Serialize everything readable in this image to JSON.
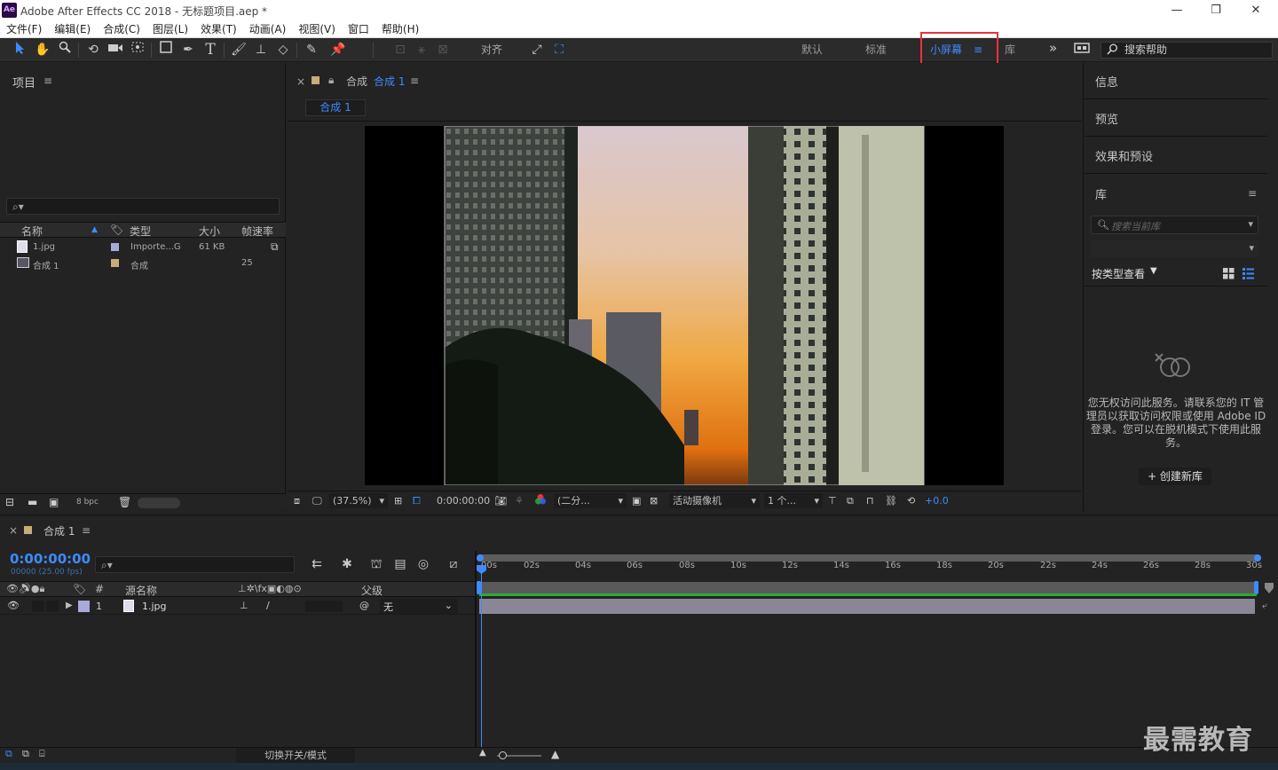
{
  "titlebar": {
    "logo": "Ae",
    "title": "Adobe After Effects CC 2018 - 无标题项目.aep *",
    "minimize": "—",
    "restore": "❐",
    "close": "✕"
  },
  "menu": [
    "文件(F)",
    "编辑(E)",
    "合成(C)",
    "图层(L)",
    "效果(T)",
    "动画(A)",
    "视图(V)",
    "窗口",
    "帮助(H)"
  ],
  "toolbar": {
    "snap_label": "对齐",
    "workspaces": [
      "默认",
      "标准",
      "小屏幕",
      "库"
    ],
    "active_workspace": "小屏幕",
    "overflow": "»",
    "search_placeholder": "搜索帮助"
  },
  "project": {
    "title": "项目",
    "columns": [
      "名称",
      "类型",
      "大小",
      "帧速率"
    ],
    "items": [
      {
        "name": "1.jpg",
        "type": "Importe...G",
        "size": "61 KB",
        "fps": "",
        "label_color": "#a9a9dd"
      },
      {
        "name": "合成 1",
        "type": "合成",
        "size": "",
        "fps": "25",
        "label_color": "#c8ac7a"
      }
    ],
    "bpc": "8 bpc"
  },
  "comp": {
    "close": "×",
    "title_prefix": "合成",
    "title_name": "合成 1",
    "tab": "合成 1",
    "zoom": "(37.5%)",
    "timecode": "0:00:00:00",
    "resolution": "(二分...",
    "camera": "活动摄像机",
    "views": "1 个...",
    "exposure": "+0.0"
  },
  "right": {
    "sections": [
      "信息",
      "预览",
      "效果和预设"
    ],
    "library": {
      "title": "库",
      "search_placeholder": "搜索当前库",
      "view_by": "按类型查看",
      "message_1": "您无权访问此服务。请联系您的 IT 管",
      "message_2": "理员以获取访问权限或使用 Adobe ID",
      "message_3": "登录。您可以在脱机模式下使用此服",
      "message_4": "务。",
      "create_button": "+ 创建新库"
    }
  },
  "timeline": {
    "close": "×",
    "title": "合成 1",
    "timecode": "0:00:00:00",
    "frame_info": "00000 (25.00 fps)",
    "columns": {
      "num": "#",
      "source_name": "源名称",
      "parent": "父级"
    },
    "layers": [
      {
        "index": "1",
        "name": "1.jpg",
        "parent": "无",
        "label_color": "#a9a9dd"
      }
    ],
    "ruler": [
      "00s",
      "02s",
      "04s",
      "06s",
      "08s",
      "10s",
      "12s",
      "14s",
      "16s",
      "18s",
      "20s",
      "22s",
      "24s",
      "26s",
      "28s",
      "30s"
    ],
    "toggle_modes": "切换开关/模式"
  },
  "watermark": "最需教育",
  "colors": {
    "accent": "#3d8bff",
    "highlight_box": "#e8333a",
    "panel_bg": "#232323",
    "work_area_green": "#2aaa3a"
  }
}
